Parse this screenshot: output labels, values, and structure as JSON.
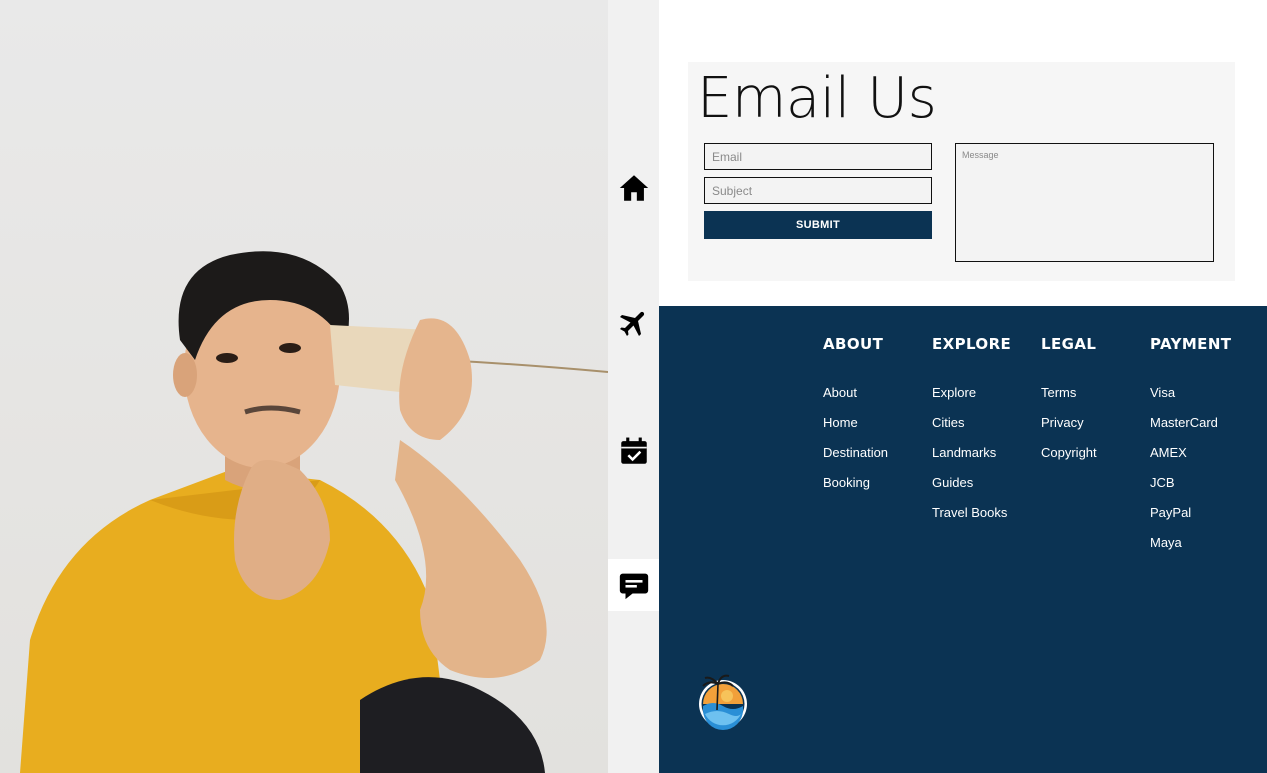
{
  "contact": {
    "title": "Email Us",
    "email_placeholder": "Email",
    "subject_placeholder": "Subject",
    "message_placeholder": "Message",
    "submit_label": "SUBMIT"
  },
  "sidebar": {
    "items": [
      {
        "icon": "home-icon",
        "active": false
      },
      {
        "icon": "airplane-icon",
        "active": false
      },
      {
        "icon": "calendar-check-icon",
        "active": false
      },
      {
        "icon": "chat-icon",
        "active": true
      }
    ]
  },
  "footer": {
    "columns": [
      {
        "heading": "ABOUT",
        "links": [
          "About",
          "Home",
          "Destination",
          "Booking"
        ]
      },
      {
        "heading": "EXPLORE",
        "links": [
          "Explore",
          "Cities",
          "Landmarks",
          "Guides",
          "Travel Books"
        ]
      },
      {
        "heading": "LEGAL",
        "links": [
          "Terms",
          "Privacy",
          "Copyright"
        ]
      },
      {
        "heading": "PAYMENT",
        "links": [
          "Visa",
          "MasterCard",
          "AMEX",
          "JCB",
          "PayPal",
          "Maya"
        ]
      }
    ]
  },
  "colors": {
    "brand_navy": "#0b3353",
    "shirt_yellow": "#e8ad1f",
    "icon_bar": "#f1f1f1"
  }
}
